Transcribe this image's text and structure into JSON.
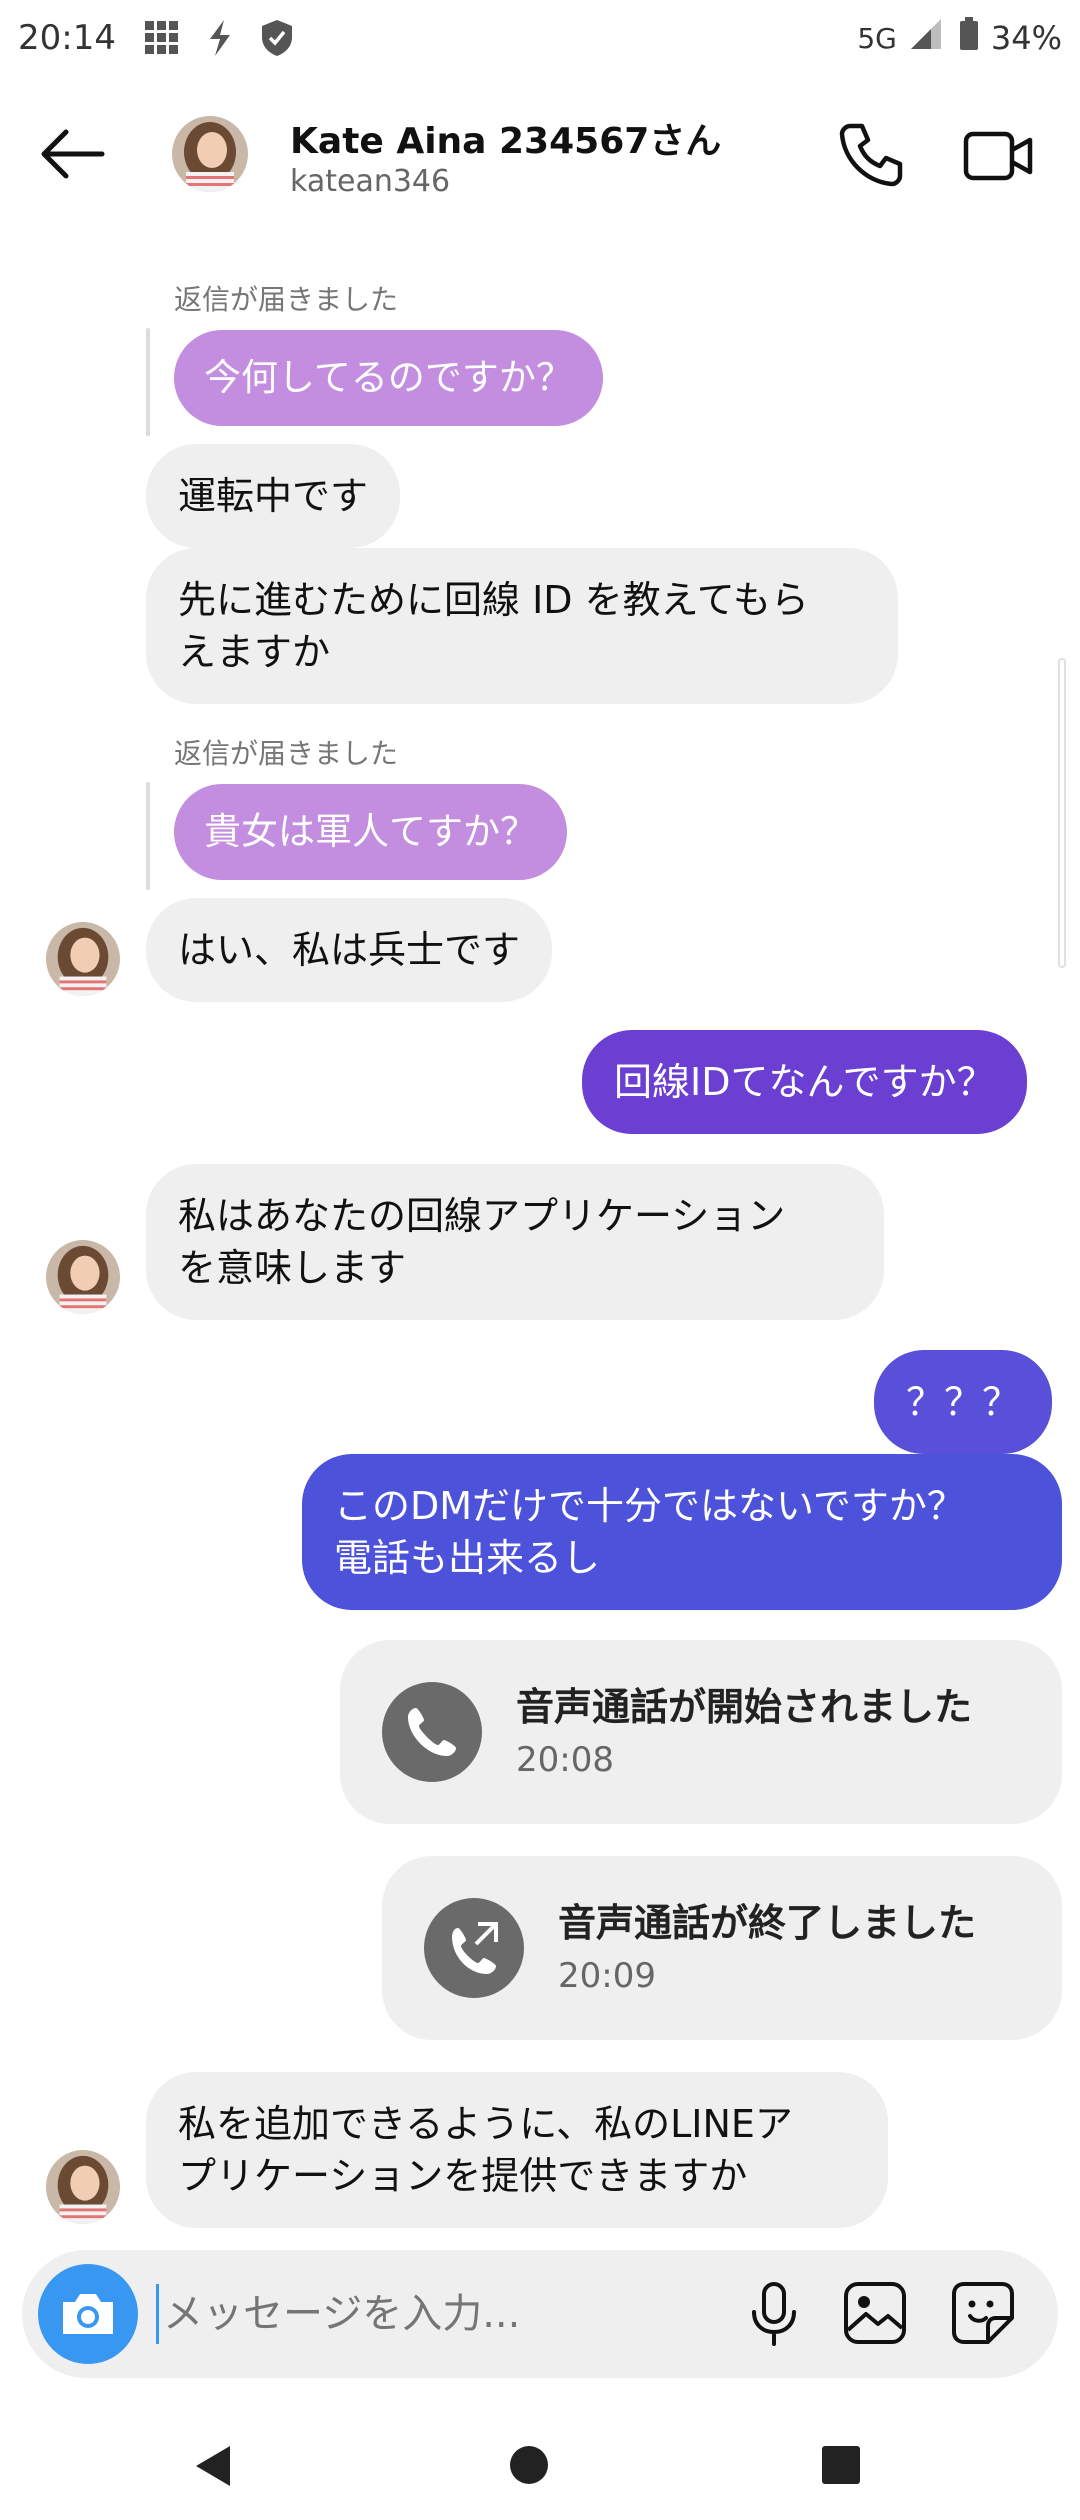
{
  "status_bar": {
    "time": "20:14",
    "network": "5G",
    "battery": "34%"
  },
  "header": {
    "name": "Kate Aina 234567さん",
    "username": "katean346"
  },
  "messages": {
    "reply_label": "返信が届きました",
    "q1": "今何してるのですか？",
    "m1": "運転中です",
    "m2": "先に進むために回線 ID を教えてもら\nえますか",
    "q2": "貴女は軍人てすか？",
    "m3": "はい、私は兵士です",
    "o1": "回線IDてなんですか？",
    "m4": "私はあなたの回線アプリケーション\nを意味します",
    "o2": "？？？",
    "o3": "このDMだけで十分ではないですか？\n電話も出来るし",
    "call_start_title": "音声通話が開始されました",
    "call_start_time": "20:08",
    "call_end_title": "音声通話が終了しました",
    "call_end_time": "20:09",
    "m5": "私を追加できるように、私のLINEア\nプリケーションを提供できますか"
  },
  "composer": {
    "placeholder": "メッセージを入力..."
  },
  "icons": {
    "back": "arrow-left-icon",
    "phone": "phone-icon",
    "video": "video-camera-icon",
    "camera": "camera-icon",
    "mic": "microphone-icon",
    "gallery": "image-icon",
    "sticker": "sticker-icon"
  },
  "colors": {
    "quoted": "#c38ee0",
    "outgoing_top": "#6a3fd2",
    "outgoing_bottom": "#4d52db",
    "accent": "#3897f0"
  }
}
